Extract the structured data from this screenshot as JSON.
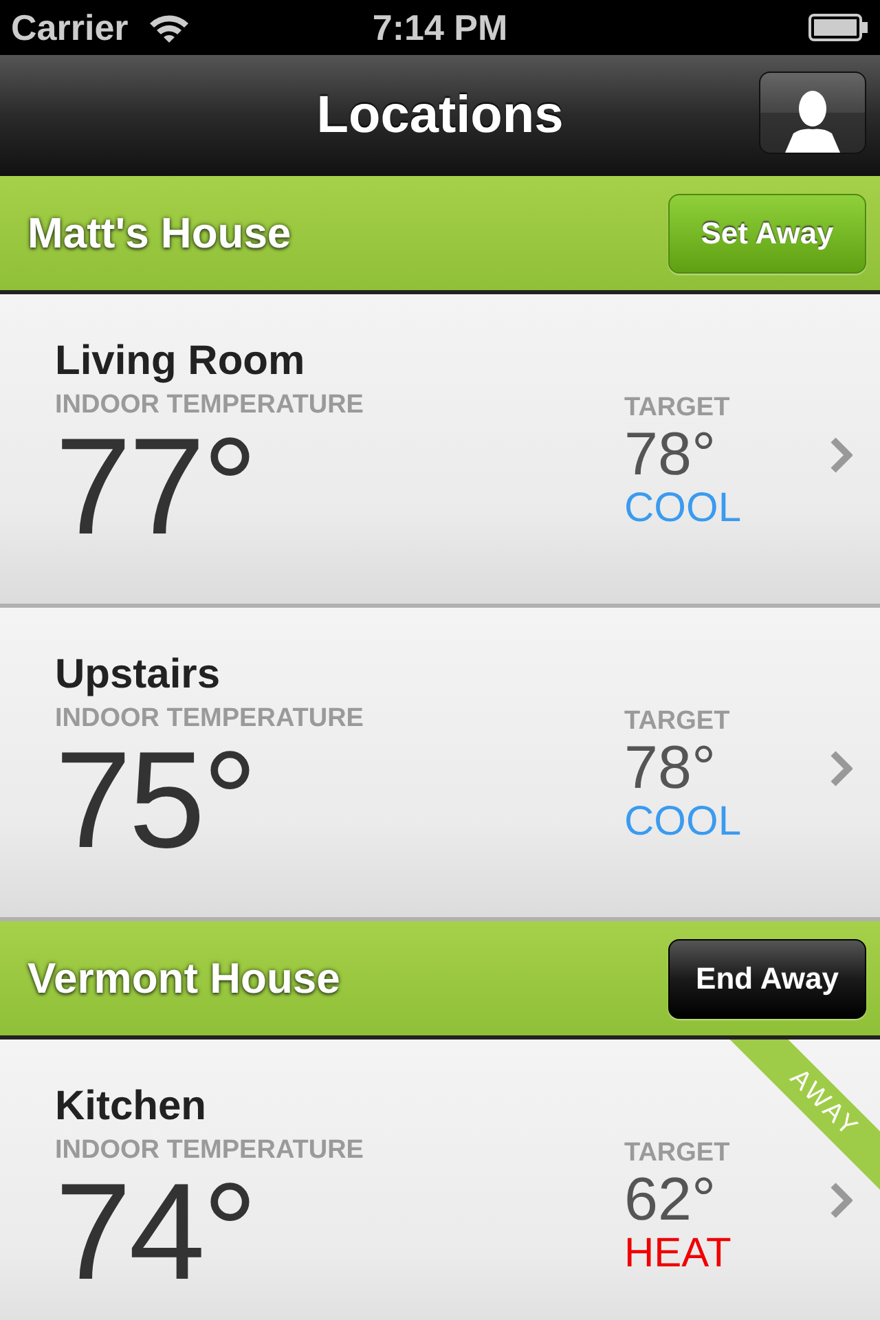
{
  "status_bar": {
    "carrier": "Carrier",
    "time": "7:14 PM"
  },
  "nav_bar": {
    "title": "Locations"
  },
  "houses": [
    {
      "name": "Matt's House",
      "button": {
        "label": "Set Away",
        "kind": "set"
      },
      "rooms": [
        {
          "name": "Living Room",
          "indoor_label": "INDOOR TEMPERATURE",
          "indoor": "77°",
          "target_label": "TARGET",
          "target": "78°",
          "mode": "COOL",
          "color": "#3a9bef",
          "away": false
        },
        {
          "name": "Upstairs",
          "indoor_label": "INDOOR TEMPERATURE",
          "indoor": "75°",
          "target_label": "TARGET",
          "target": "78°",
          "mode": "COOL",
          "color": "#3a9bef",
          "away": false
        }
      ]
    },
    {
      "name": "Vermont House",
      "button": {
        "label": "End Away",
        "kind": "end"
      },
      "rooms": [
        {
          "name": "Kitchen",
          "indoor_label": "INDOOR TEMPERATURE",
          "indoor": "74°",
          "target_label": "TARGET",
          "target": "62°",
          "mode": "HEAT",
          "color": "#f00000",
          "away": true,
          "away_badge": "AWAY"
        }
      ]
    }
  ]
}
